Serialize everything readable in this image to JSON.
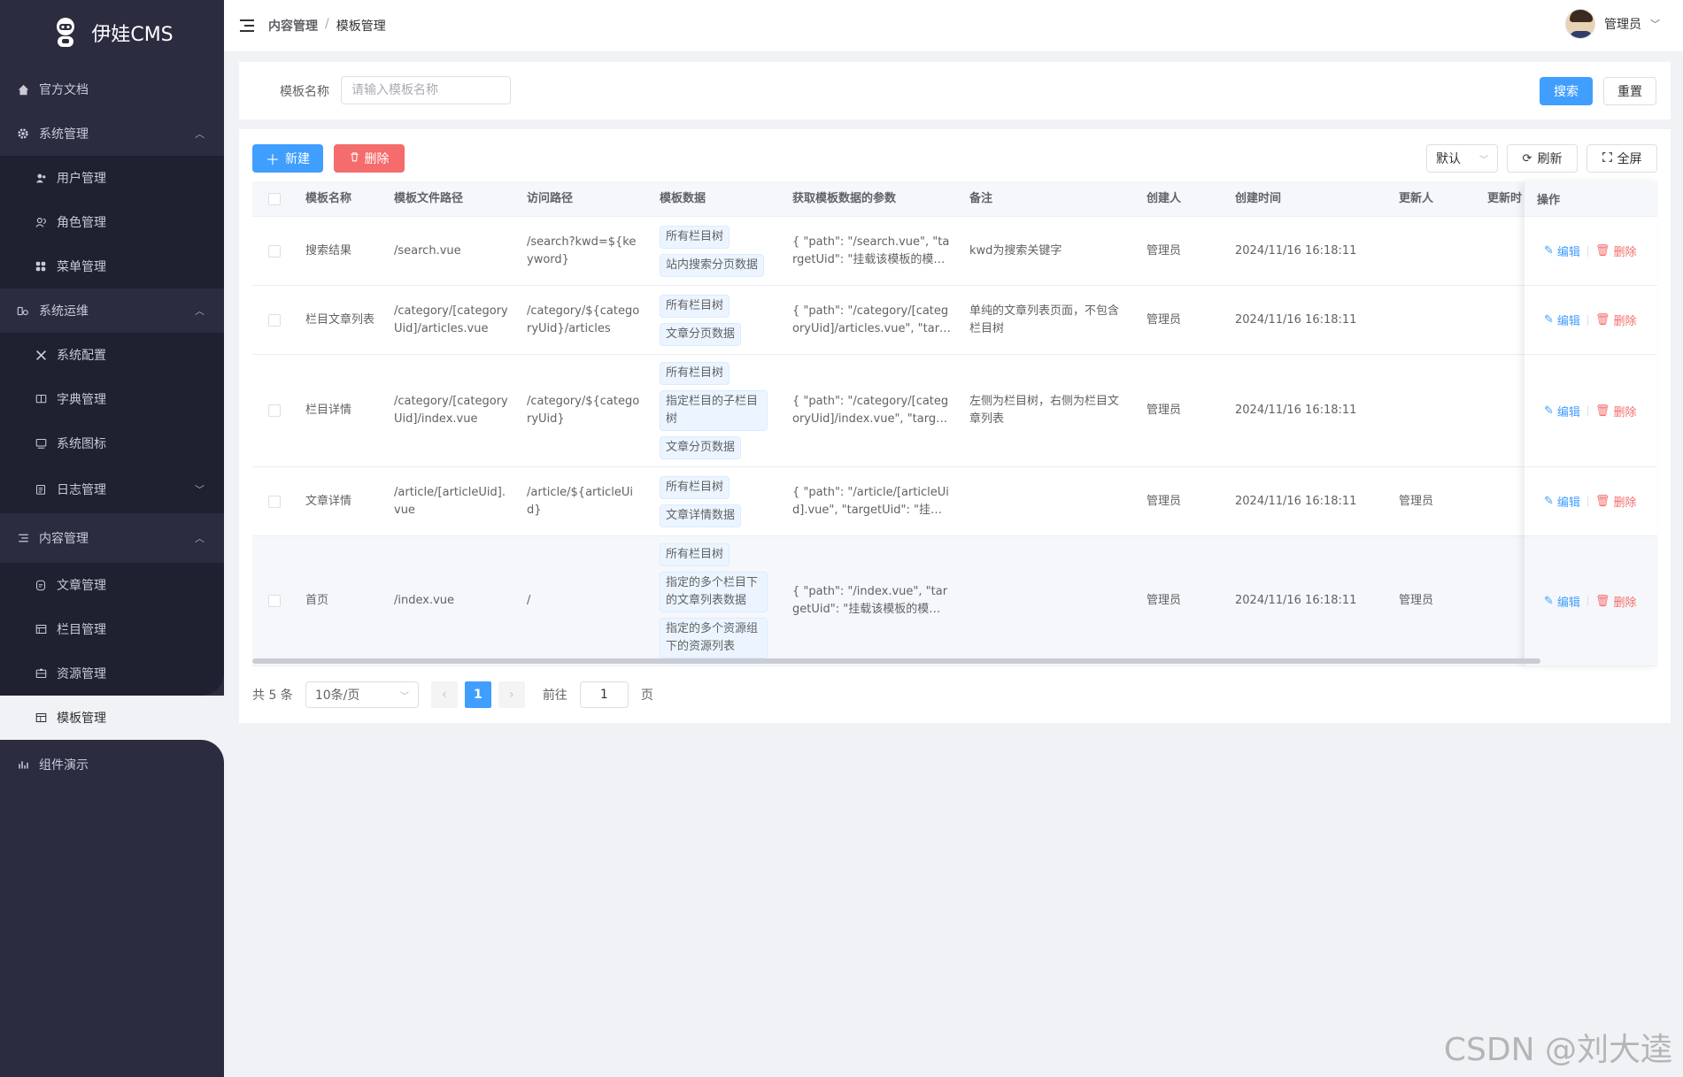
{
  "app": {
    "title": "伊娃CMS"
  },
  "sidebar": {
    "items": [
      {
        "label": "官方文档",
        "icon": "home-icon"
      },
      {
        "label": "系统管理",
        "icon": "gear-icon",
        "expanded": true
      },
      {
        "label": "用户管理",
        "icon": "user-icon"
      },
      {
        "label": "角色管理",
        "icon": "users-icon"
      },
      {
        "label": "菜单管理",
        "icon": "grid-icon"
      },
      {
        "label": "系统运维",
        "icon": "ops-icon",
        "expanded": true
      },
      {
        "label": "系统配置",
        "icon": "tools-icon"
      },
      {
        "label": "字典管理",
        "icon": "book-icon"
      },
      {
        "label": "系统图标",
        "icon": "image-icon"
      },
      {
        "label": "日志管理",
        "icon": "clipboard-icon",
        "expanded": false
      },
      {
        "label": "内容管理",
        "icon": "list-icon",
        "expanded": true
      },
      {
        "label": "文章管理",
        "icon": "doc-icon"
      },
      {
        "label": "栏目管理",
        "icon": "columns-icon"
      },
      {
        "label": "资源管理",
        "icon": "folder-icon"
      },
      {
        "label": "模板管理",
        "icon": "template-icon",
        "active": true
      },
      {
        "label": "组件演示",
        "icon": "chart-icon"
      }
    ]
  },
  "header": {
    "breadcrumb": [
      "内容管理",
      "/",
      "模板管理"
    ],
    "user": "管理员"
  },
  "search": {
    "label": "模板名称",
    "placeholder": "请输入模板名称",
    "search_btn": "搜索",
    "reset_btn": "重置"
  },
  "toolbar": {
    "new_btn": "新建",
    "delete_btn": "删除",
    "size_select": "默认",
    "refresh_btn": "刷新",
    "fullscreen_btn": "全屏"
  },
  "table": {
    "headers": [
      "模板名称",
      "模板文件路径",
      "访问路径",
      "模板数据",
      "获取模板数据的参数",
      "备注",
      "创建人",
      "创建时间",
      "更新人",
      "更新时",
      "操作"
    ],
    "rows": [
      {
        "name": "搜索结果",
        "file": "/search.vue",
        "path": "/search?kwd=${keyword}",
        "tags": [
          "所有栏目树",
          "站内搜索分页数据"
        ],
        "params": "{ \"path\": \"/search.vue\", \"targetUid\": \"挂载该模板的模块数据\" }",
        "remark": "kwd为搜索关键字",
        "creator": "管理员",
        "created": "2024/11/16 16:18:11",
        "updater": ""
      },
      {
        "name": "栏目文章列表",
        "file": "/category/[categoryUid]/articles.vue",
        "path": "/category/${categoryUid}/articles",
        "tags": [
          "所有栏目树",
          "文章分页数据"
        ],
        "params": "{ \"path\": \"/category/[categoryUid]/articles.vue\", \"targetUid\": \"\" }",
        "remark": "单纯的文章列表页面，不包含栏目树",
        "creator": "管理员",
        "created": "2024/11/16 16:18:11",
        "updater": ""
      },
      {
        "name": "栏目详情",
        "file": "/category/[categoryUid]/index.vue",
        "path": "/category/${categoryUid}",
        "tags": [
          "所有栏目树",
          "指定栏目的子栏目树",
          "文章分页数据"
        ],
        "params": "{ \"path\": \"/category/[categoryUid]/index.vue\", \"targetUid\": \"\" }",
        "remark": "左侧为栏目树，右侧为栏目文章列表",
        "creator": "管理员",
        "created": "2024/11/16 16:18:11",
        "updater": ""
      },
      {
        "name": "文章详情",
        "file": "/article/[articleUid].vue",
        "path": "/article/${articleUid}",
        "tags": [
          "所有栏目树",
          "文章详情数据"
        ],
        "params": "{ \"path\": \"/article/[articleUid].vue\", \"targetUid\": \"挂载该模板的模块\" }",
        "remark": "",
        "creator": "管理员",
        "created": "2024/11/16 16:18:11",
        "updater": "管理员"
      },
      {
        "name": "首页",
        "file": "/index.vue",
        "path": "/",
        "tags": [
          "所有栏目树",
          "指定的多个栏目下的文章列表数据",
          "指定的多个资源组下的资源列表"
        ],
        "params": "{ \"path\": \"/index.vue\", \"targetUid\": \"挂载该模板的模块数据\" }",
        "remark": "",
        "creator": "管理员",
        "created": "2024/11/16 16:18:11",
        "updater": "管理员"
      }
    ],
    "op_edit": "编辑",
    "op_delete": "删除"
  },
  "pagination": {
    "total": "共 5 条",
    "page_size": "10条/页",
    "current": "1",
    "goto_prefix": "前往",
    "goto_value": "1",
    "goto_suffix": "页"
  },
  "watermark": "CSDN @刘大逵",
  "colors": {
    "primary": "#409eff",
    "danger": "#f56c6c",
    "sidebar": "#2b2c40"
  }
}
